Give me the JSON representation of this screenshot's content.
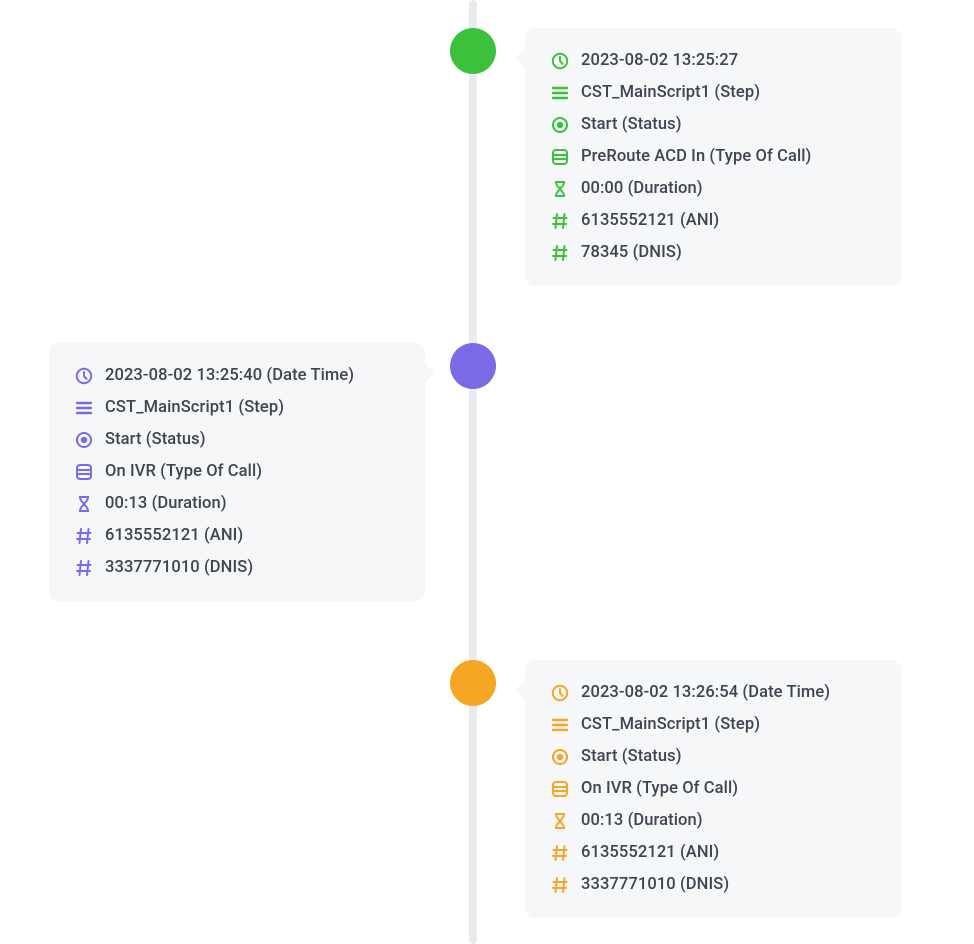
{
  "events": [
    {
      "color": "green",
      "side": "right",
      "rows": [
        {
          "icon": "clock",
          "text": "2023-08-02 13:25:27"
        },
        {
          "icon": "lines",
          "text": "CST_MainScript1 (Step)"
        },
        {
          "icon": "radio",
          "text": "Start (Status)"
        },
        {
          "icon": "db",
          "text": "PreRoute ACD In (Type Of Call)"
        },
        {
          "icon": "hourglass",
          "text": "00:00 (Duration)"
        },
        {
          "icon": "hash",
          "text": "6135552121 (ANI)"
        },
        {
          "icon": "hash",
          "text": "78345 (DNIS)"
        }
      ]
    },
    {
      "color": "purple",
      "side": "left",
      "rows": [
        {
          "icon": "clock",
          "text": "2023-08-02 13:25:40 (Date Time)"
        },
        {
          "icon": "lines",
          "text": "CST_MainScript1 (Step)"
        },
        {
          "icon": "radio",
          "text": "Start (Status)"
        },
        {
          "icon": "db",
          "text": "On IVR (Type Of Call)"
        },
        {
          "icon": "hourglass",
          "text": "00:13 (Duration)"
        },
        {
          "icon": "hash",
          "text": "6135552121 (ANI)"
        },
        {
          "icon": "hash",
          "text": "3337771010 (DNIS)"
        }
      ]
    },
    {
      "color": "orange",
      "side": "right",
      "rows": [
        {
          "icon": "clock",
          "text": "2023-08-02 13:26:54 (Date Time)"
        },
        {
          "icon": "lines",
          "text": "CST_MainScript1 (Step)"
        },
        {
          "icon": "radio",
          "text": "Start (Status)"
        },
        {
          "icon": "db",
          "text": "On IVR (Type Of Call)"
        },
        {
          "icon": "hourglass",
          "text": "00:13 (Duration)"
        },
        {
          "icon": "hash",
          "text": "6135552121 (ANI)"
        },
        {
          "icon": "hash",
          "text": "3337771010 (DNIS)"
        }
      ]
    }
  ]
}
